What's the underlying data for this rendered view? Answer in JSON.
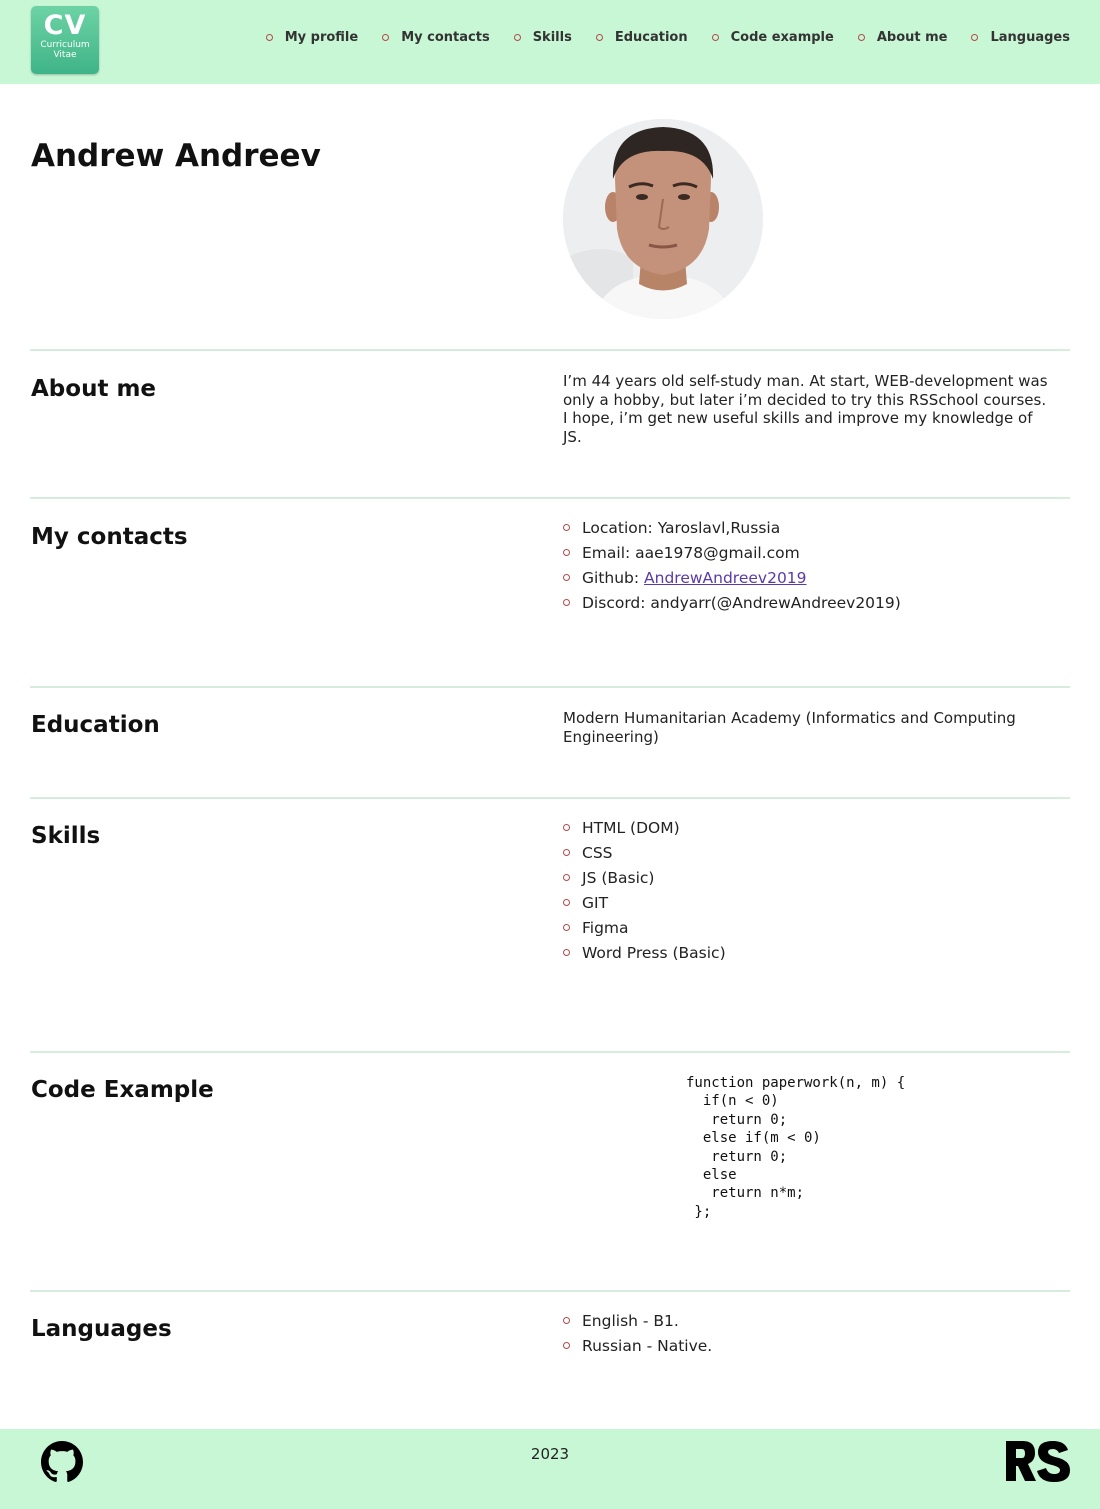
{
  "header": {
    "logo_title": "CV",
    "logo_line1": "Curriculum",
    "logo_line2": "Vitae",
    "nav": [
      {
        "label": "My profile"
      },
      {
        "label": "My contacts"
      },
      {
        "label": "Skills"
      },
      {
        "label": "Education"
      },
      {
        "label": "Code example"
      },
      {
        "label": "About me"
      },
      {
        "label": "Languages"
      }
    ]
  },
  "profile": {
    "name": "Andrew Andreev",
    "avatar_icon": "avatar-photo"
  },
  "about": {
    "title": "About me",
    "text": "I’m 44 years old self-study man. At start, WEB-development was only a hobby, but later i’m decided to try this RSSchool courses. I hope, i’m get new useful skills and improve my knowledge of JS."
  },
  "contacts": {
    "title": "My contacts",
    "location": "Location: Yaroslavl,Russia",
    "email": "Email: aae1978@gmail.com",
    "github_label": "Github: ",
    "github_link": "AndrewAndreev2019",
    "discord": "Discord: andyarr(@AndrewAndreev2019)"
  },
  "education": {
    "title": "Education",
    "text": "Modern Humanitarian Academy (Informatics and Computing Engineering)"
  },
  "skills": {
    "title": "Skills",
    "items": [
      "HTML (DOM)",
      "CSS",
      "JS (Basic)",
      "GIT",
      "Figma",
      "Word Press (Basic)"
    ]
  },
  "code": {
    "title": "Code Example",
    "snippet": "function paperwork(n, m) {\n  if(n < 0)\n   return 0;\n  else if(m < 0)\n   return 0;\n  else\n   return n*m;\n };"
  },
  "languages": {
    "title": "Languages",
    "items": [
      "English - B1.",
      "Russian - Native."
    ]
  },
  "footer": {
    "year": "2023",
    "left_icon": "github-icon",
    "right_icon": "rs-school-logo"
  },
  "colors": {
    "header_bg": "#c8f7d6",
    "bullet": "#b24a4a",
    "divider": "#d6ecdd",
    "link": "#5a3aa6"
  }
}
